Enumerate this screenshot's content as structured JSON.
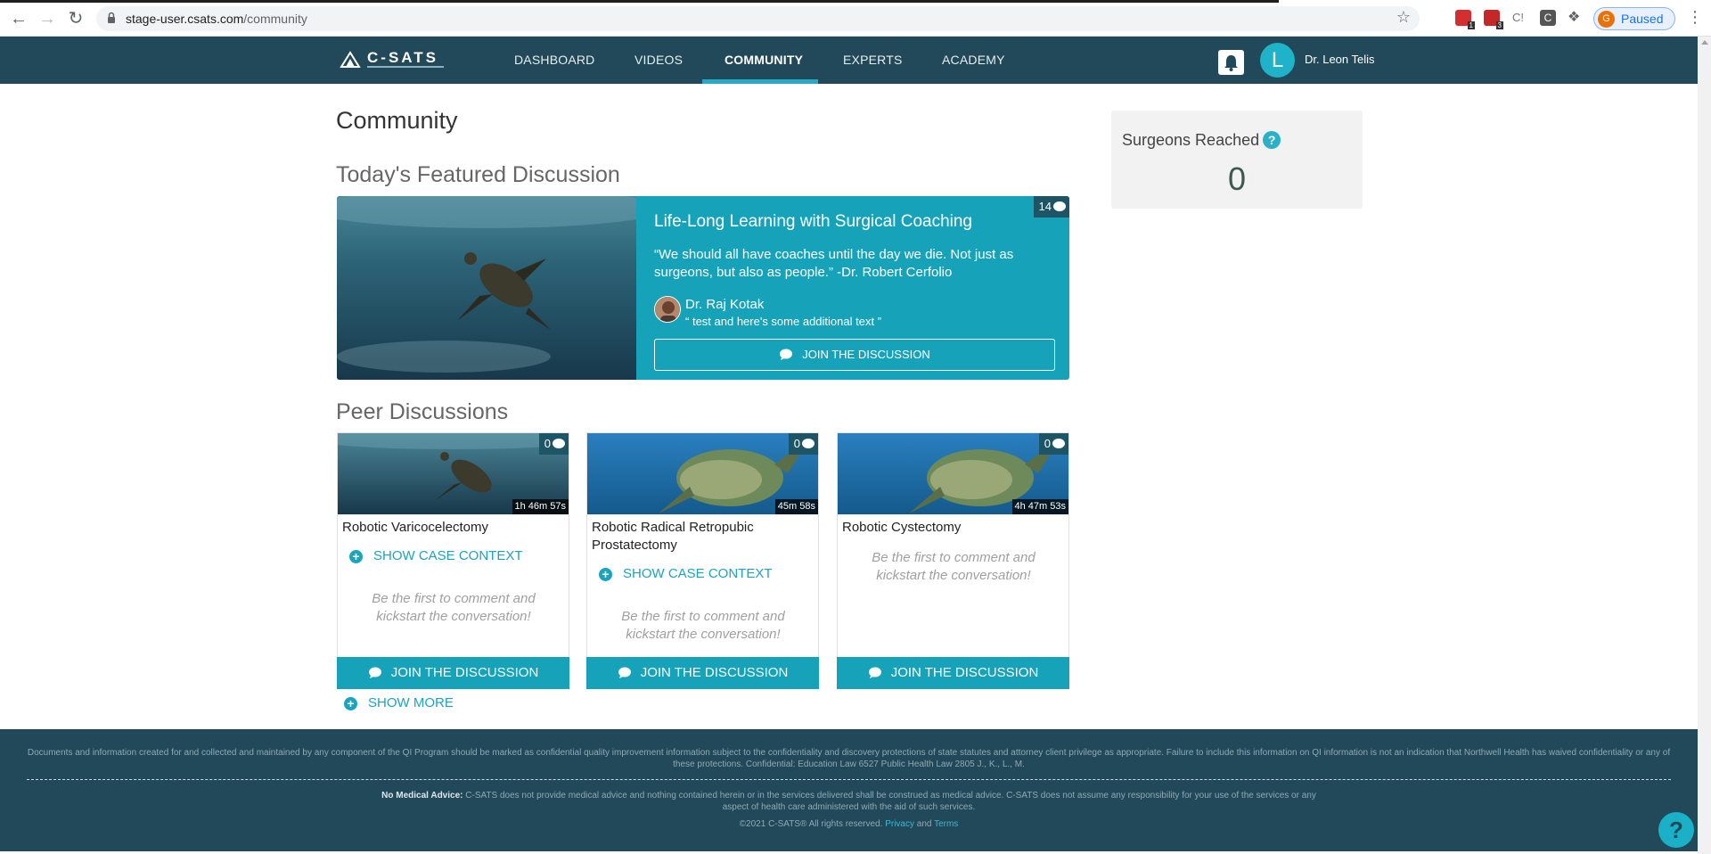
{
  "browser": {
    "url_host": "stage-user.csats.com",
    "url_path": "/community",
    "profile_initial": "G",
    "profile_status": "Paused",
    "ext_badges": [
      "1",
      "3"
    ],
    "ext_labels": [
      "C!",
      "C"
    ]
  },
  "header": {
    "logo_text": "C-SATS",
    "nav": [
      {
        "label": "DASHBOARD"
      },
      {
        "label": "VIDEOS"
      },
      {
        "label": "COMMUNITY",
        "active": true
      },
      {
        "label": "EXPERTS"
      },
      {
        "label": "ACADEMY"
      }
    ],
    "user_initial": "L",
    "user_name": "Dr. Leon Telis"
  },
  "page": {
    "title": "Community",
    "featured_heading": "Today's Featured Discussion",
    "peer_heading": "Peer Discussions"
  },
  "featured": {
    "comment_count": "14",
    "title": "Life-Long Learning with Surgical Coaching",
    "quote": "“We should all have coaches until the day we die. Not just as surgeons, but also as people.” -Dr. Robert Cerfolio",
    "author": "Dr. Raj Kotak",
    "comment": "test and here's some additional text",
    "button_label": "JOIN THE DISCUSSION"
  },
  "peer": [
    {
      "comments": "0",
      "duration": "1h 46m 57s",
      "title": "Robotic Varicocelectomy",
      "context_label": "SHOW CASE CONTEXT",
      "empty_text": "Be the first to comment and kickstart the conversation!",
      "button_label": "JOIN THE DISCUSSION"
    },
    {
      "comments": "0",
      "duration": "45m 58s",
      "title": "Robotic Radical Retropubic Prostatectomy",
      "context_label": "SHOW CASE CONTEXT",
      "empty_text": "Be the first to comment and kickstart the conversation!",
      "button_label": "JOIN THE DISCUSSION"
    },
    {
      "comments": "0",
      "duration": "4h 47m 53s",
      "title": "Robotic Cystectomy",
      "empty_text": "Be the first to comment and kickstart the conversation!",
      "button_label": "JOIN THE DISCUSSION"
    }
  ],
  "show_more_label": "SHOW MORE",
  "reach": {
    "label": "Surgeons Reached",
    "help": "?",
    "value": "0"
  },
  "footer": {
    "legal": "Documents and information created for and collected and maintained by any component of the QI Program should be marked as confidential quality improvement information subject to the confidentiality and discovery protections of state statutes and attorney client privilege as appropriate. Failure to include this information on QI information is not an indication that Northwell Health has waived confidentiality or any of these protections. Confidential: Education Law 6527 Public Health Law 2805 J., K., L., M.",
    "no_med_title": "No Medical Advice:",
    "no_med_text": "C-SATS does not provide medical advice and nothing contained herein or in the services delivered shall be construed as medical advice. C-SATS does not assume any responsibility for your use of the services or any aspect of health care administered with the aid of such services.",
    "copyright": "©2021 C-SATS® All rights reserved.",
    "privacy": "Privacy",
    "and": "and",
    "terms": "Terms",
    "help_icon": "?"
  },
  "colors": {
    "header": "#21495a",
    "accent": "#16a3ba",
    "footer": "#21495a"
  }
}
